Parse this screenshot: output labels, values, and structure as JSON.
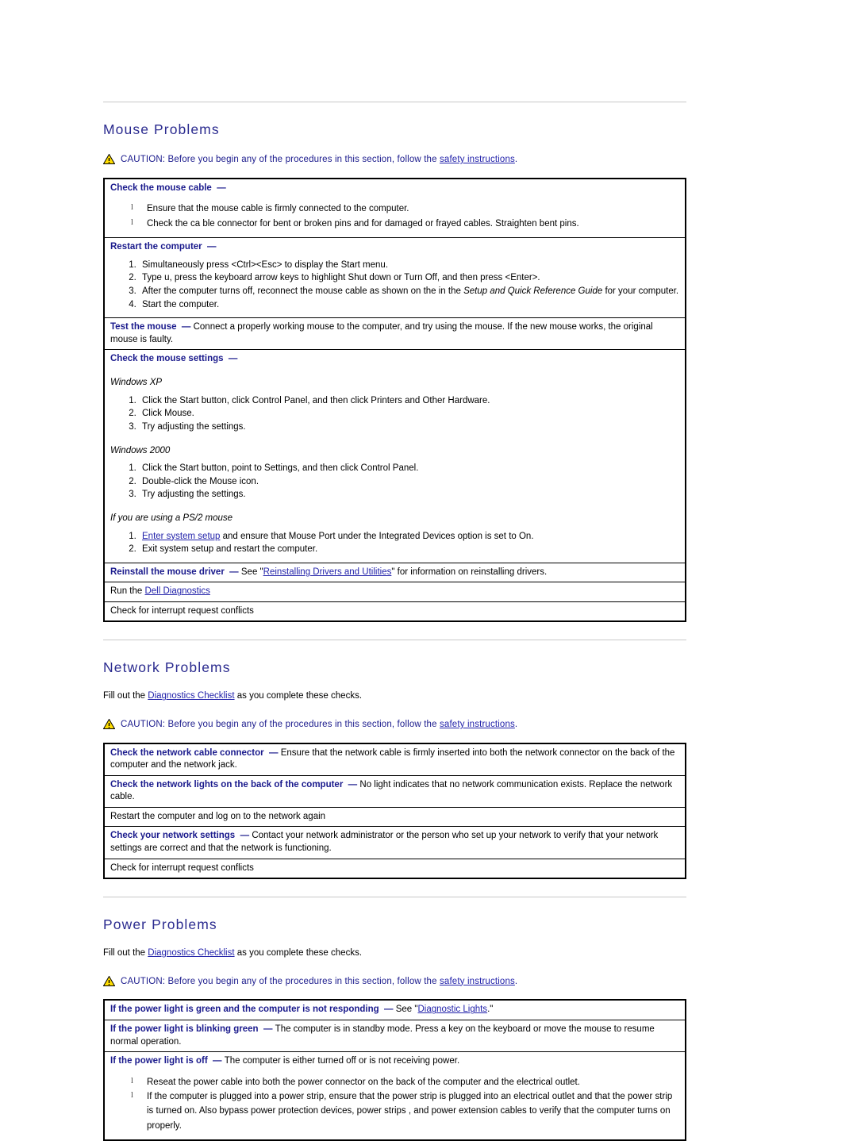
{
  "colors": {
    "heading": "#2b2b8f",
    "link": "#2222aa",
    "caution_text": "#1a1a8c",
    "warning_triangle": "#ffdd00",
    "rule": "#c8c8c8"
  },
  "caution": {
    "label": "CAUTION:",
    "body_before": "Before you begin any of the procedures in this section, follow the",
    "link": "safety instructions",
    "period": "."
  },
  "checklist_intro": {
    "before": "Fill out the",
    "link": "Diagnostics Checklist",
    "after": "as you complete these checks."
  },
  "sections": [
    {
      "title": "Mouse Problems",
      "rows": [
        {
          "head": "Check the mouse cable",
          "bullets": [
            "Ensure that the mouse cable is firmly connected to the computer.",
            "Check the ca ble connector for bent or broken pins and for damaged or frayed cables. Straighten bent pins."
          ]
        },
        {
          "head": "Restart the computer",
          "steps": [
            "Simultaneously press <Ctrl><Esc> to display the  Start menu.",
            "Type  u, press the keyboard arrow keys to highlight Shut down or Turn Off, and then press <Enter>.",
            "After the computer turns off, reconnect the mouse cable as shown on the in the  Setup and Quick Reference Guide for your computer.",
            "Start the computer."
          ],
          "steps_italic_part": "Setup and Quick Reference Guide"
        },
        {
          "head": "Test the mouse",
          "body": "Connect a properly working mouse to the computer, and try using the mouse. If the new mouse works, the original mouse is faulty."
        },
        {
          "head": "Check the mouse settings",
          "groups": [
            {
              "subhead": "Windows XP",
              "steps": [
                "Click the  Start button, click Control Panel, and then click Printers and Other Hardware.",
                "Click  Mouse.",
                "Try adjusting the settings."
              ]
            },
            {
              "subhead": "Windows 2000",
              "steps": [
                "Click the  Start button, point to Settings, and then click Control Panel.",
                "Double-click the  Mouse icon.",
                "Try adjusting the settings."
              ]
            },
            {
              "subhead": "If you are using a PS/2 mouse",
              "steps_link": {
                "link": "Enter system setup",
                "after": "and ensure that Mouse Port under the Integrated Devices option is set to On."
              },
              "step2": "Exit system setup and restart the computer."
            }
          ]
        },
        {
          "head": "Reinstall the mouse driver",
          "body_before": "See \"",
          "link": "Reinstalling Drivers and Utilities",
          "body_after": "\" for information on reinstalling drivers."
        },
        {
          "plain_before": "Run the",
          "plain_link": "Dell Diagnostics"
        },
        {
          "plain_blue": "Check for interrupt request conflicts"
        }
      ]
    },
    {
      "title": "Network Problems",
      "rows": [
        {
          "head": "Check the network cable connector",
          "body": "Ensure that the network cable is firmly inserted into both the network connector on the back of the computer and the network jack."
        },
        {
          "head": "Check the network lights on the back of the computer",
          "body": "No light indicates that no network communication exists. Replace the network cable."
        },
        {
          "plain_blue": "Restart the computer and log on to the network again"
        },
        {
          "head": "Check your network settings",
          "body": "Contact your network administrator or the person who set up your network to verify that your network settings are correct and that the network is functioning."
        },
        {
          "plain_blue": "Check for interrupt request conflicts"
        }
      ]
    },
    {
      "title": "Power Problems",
      "rows": [
        {
          "head": "If the power light is green and the computer is not responding",
          "body_before": "See \"",
          "link": "Diagnostic Lights",
          "body_after": ".\""
        },
        {
          "head": "If the power light is blinking green",
          "body": "The computer is in standby mode. Press a key on the keyboard or move the mouse to resume normal operation."
        },
        {
          "head": "If the power light is off",
          "body": "The computer is either turned off or is not receiving power.",
          "bullets": [
            "Reseat the power cable into both the power connector  on the back of the computer and the electrical outlet.",
            "If the computer is plugged into a power strip, ensure that the power strip is plugged into an electrical outlet and that the power strip is turned on. Also bypass power protection devices, power strips , and power extension cables to verify that the computer turns on properly."
          ]
        }
      ]
    }
  ]
}
